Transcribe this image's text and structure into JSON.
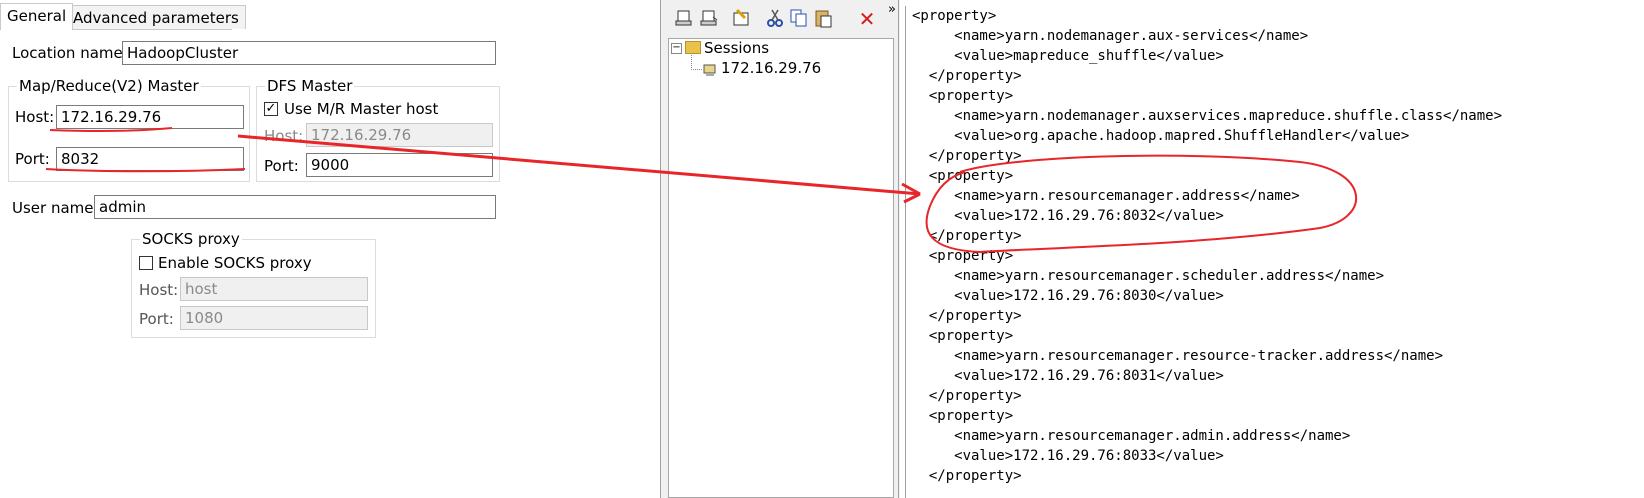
{
  "tabs": [
    {
      "label": "General",
      "active": true
    },
    {
      "label": "Advanced parameters",
      "active": false
    }
  ],
  "location": {
    "label": "Location name:",
    "value": "HadoopCluster"
  },
  "mr_master": {
    "title": "Map/Reduce(V2) Master",
    "host_label": "Host:",
    "host_value": "172.16.29.76",
    "port_label": "Port:",
    "port_value": "8032"
  },
  "dfs_master": {
    "title": "DFS Master",
    "checkbox_label": "Use M/R Master host",
    "checkbox_checked": true,
    "host_label": "Host:",
    "host_value": "172.16.29.76",
    "port_label": "Port:",
    "port_value": "9000"
  },
  "user": {
    "label": "User name:",
    "value": "admin"
  },
  "socks": {
    "title": "SOCKS proxy",
    "checkbox_label": "Enable SOCKS proxy",
    "checkbox_checked": false,
    "host_label": "Host:",
    "host_placeholder": "host",
    "port_label": "Port:",
    "port_value": "1080"
  },
  "toolbar": {
    "overflow": "»",
    "icons": [
      "new-session-icon",
      "open-session-icon",
      "properties-icon",
      "cut-icon",
      "copy-icon",
      "paste-icon",
      "delete-icon"
    ]
  },
  "tree": {
    "root_label": "Sessions",
    "root_expander": "−",
    "children": [
      "172.16.29.76"
    ]
  },
  "xml_lines": [
    "<property>",
    "     <name>yarn.nodemanager.aux-services</name>",
    "     <value>mapreduce_shuffle</value>",
    "  </property>",
    "  <property>",
    "     <name>yarn.nodemanager.auxservices.mapreduce.shuffle.class</name>",
    "     <value>org.apache.hadoop.mapred.ShuffleHandler</value>",
    "  </property>",
    "  <property>",
    "     <name>yarn.resourcemanager.address</name>",
    "     <value>172.16.29.76:8032</value>",
    "  </property>",
    "  <property>",
    "     <name>yarn.resourcemanager.scheduler.address</name>",
    "     <value>172.16.29.76:8030</value>",
    "  </property>",
    "  <property>",
    "     <name>yarn.resourcemanager.resource-tracker.address</name>",
    "     <value>172.16.29.76:8031</value>",
    "  </property>",
    "  <property>",
    "     <name>yarn.resourcemanager.admin.address</name>",
    "     <value>172.16.29.76:8033</value>",
    "  </property>"
  ],
  "colors": {
    "annotation": "#e8262a",
    "folder": "#e8c24a",
    "delete": "#d61a1a"
  }
}
